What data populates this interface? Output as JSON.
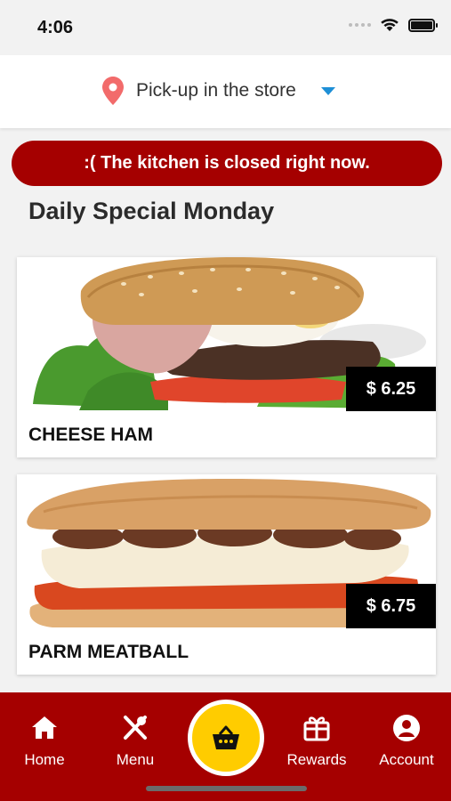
{
  "status_bar": {
    "time": "4:06"
  },
  "location": {
    "label": "Pick-up in the store"
  },
  "banner": {
    "text": ":( The kitchen is closed right now."
  },
  "section": {
    "title": "Daily Special Monday"
  },
  "products": [
    {
      "name": "CHEESE HAM",
      "price": "$ 6.25",
      "image": "burger-image"
    },
    {
      "name": "PARM MEATBALL",
      "price": "$ 6.75",
      "image": "sub-sandwich-image"
    }
  ],
  "nav": {
    "items": [
      {
        "label": "Home",
        "icon": "home-icon"
      },
      {
        "label": "Menu",
        "icon": "utensils-icon"
      },
      {
        "label": "",
        "icon": "basket-icon"
      },
      {
        "label": "Rewards",
        "icon": "gift-icon"
      },
      {
        "label": "Account",
        "icon": "account-icon"
      }
    ]
  },
  "colors": {
    "brand_red": "#a50000",
    "basket_yellow": "#ffcc00",
    "pin_red": "#f26b6b",
    "caret_blue": "#1e8fd6"
  }
}
